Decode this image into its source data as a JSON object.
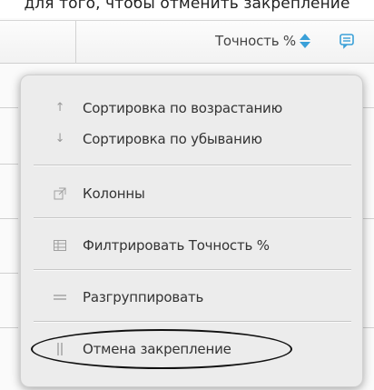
{
  "caption": "для того, чтобы отменить закрепление",
  "header": {
    "column_label": "Точность %"
  },
  "menu": {
    "items": [
      {
        "icon": "arrow-up-icon",
        "label": "Сортировка по возрастанию"
      },
      {
        "icon": "arrow-down-icon",
        "label": "Сортировка по убыванию"
      },
      {
        "icon": "columns-icon",
        "label": "Колонны"
      },
      {
        "icon": "filter-icon",
        "label": "Филтрировать Точность %"
      },
      {
        "icon": "ungroup-icon",
        "label": "Разгруппировать"
      },
      {
        "icon": "unpin-icon",
        "label": "Отмена закрепление"
      }
    ]
  },
  "colors": {
    "accent": "#3aa0d8",
    "menu_bg": "#ececec"
  }
}
